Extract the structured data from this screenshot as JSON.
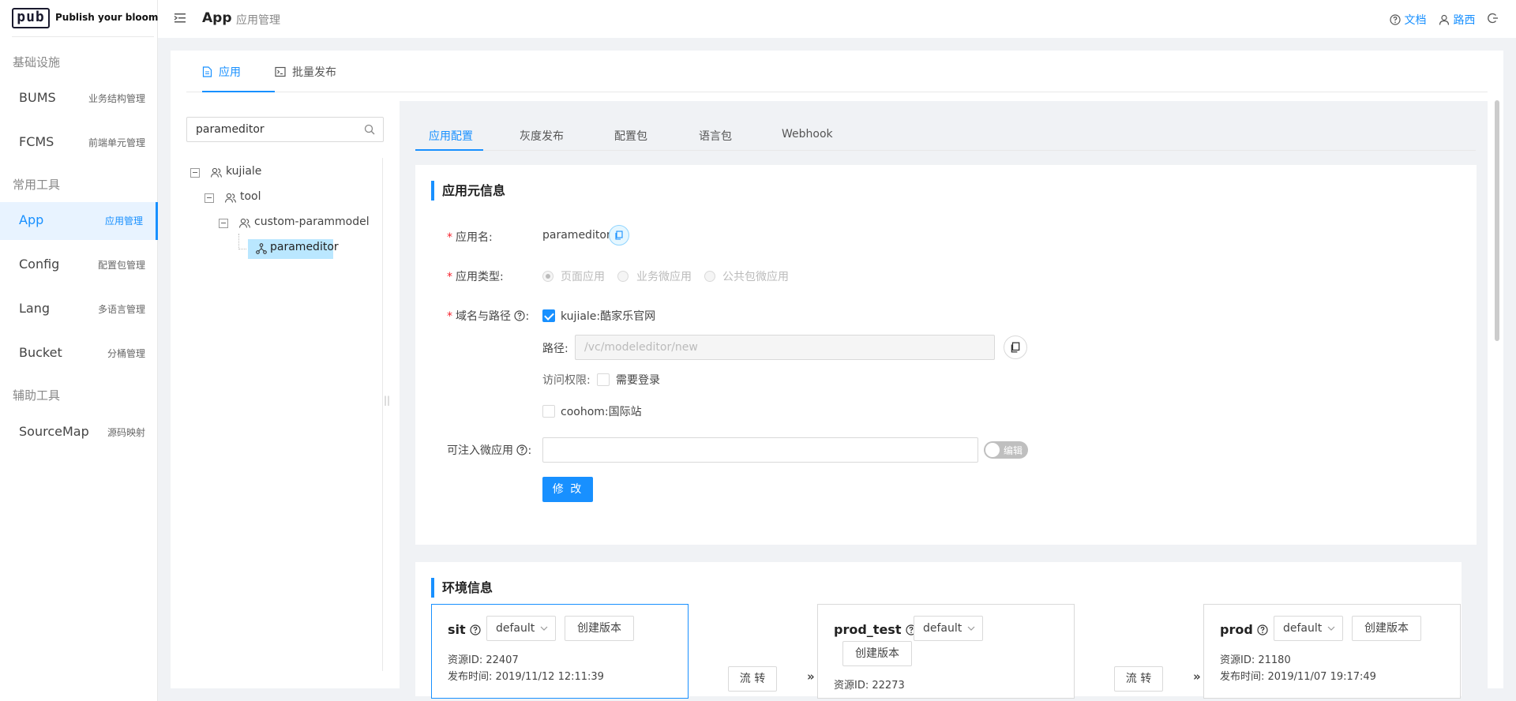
{
  "brand": {
    "logo": "pub",
    "tagline": "Publish your bloom!"
  },
  "sidebar": {
    "groups": [
      "基础设施",
      "常用工具",
      "辅助工具"
    ],
    "items": [
      {
        "en": "BUMS",
        "cn": "业务结构管理"
      },
      {
        "en": "FCMS",
        "cn": "前端单元管理"
      },
      {
        "en": "App",
        "cn": "应用管理"
      },
      {
        "en": "Config",
        "cn": "配置包管理"
      },
      {
        "en": "Lang",
        "cn": "多语言管理"
      },
      {
        "en": "Bucket",
        "cn": "分桶管理"
      },
      {
        "en": "SourceMap",
        "cn": "源码映射"
      }
    ],
    "active_index": 2
  },
  "header": {
    "title": "App",
    "subtitle": "应用管理",
    "docs": "文档",
    "user": "路西"
  },
  "main_tabs": [
    {
      "label": "应用",
      "icon": "file-icon"
    },
    {
      "label": "批量发布",
      "icon": "terminal-icon"
    }
  ],
  "search": {
    "value": "parameditor"
  },
  "tree": [
    {
      "label": "kujiale",
      "icon": "team-icon"
    },
    {
      "label": "tool",
      "icon": "team-icon"
    },
    {
      "label": "custom-parammodel",
      "icon": "team-icon"
    },
    {
      "label": "parameditor",
      "icon": "app-node-icon",
      "selected": true
    }
  ],
  "sub_tabs": [
    "应用配置",
    "灰度发布",
    "配置包",
    "语言包",
    "Webhook"
  ],
  "meta_card": {
    "title": "应用元信息",
    "app_name_label": "应用名:",
    "app_name": "parameditor",
    "app_type_label": "应用类型:",
    "app_types": [
      "页面应用",
      "业务微应用",
      "公共包微应用"
    ],
    "domain_label": "域名与路径",
    "domain_primary": "kujiale:酷家乐官网",
    "path_label": "路径:",
    "path_value": "/vc/modeleditor/new",
    "access_label": "访问权限:",
    "access_login": "需要登录",
    "domain_secondary": "coohom:国际站",
    "inject_label": "可注入微应用",
    "toggle_label": "编辑",
    "submit": "修 改"
  },
  "env_card": {
    "title": "环境信息",
    "envs": [
      {
        "name": "sit",
        "branch": "default",
        "create": "创建版本",
        "resource": "资源ID:  22407",
        "published": "发布时间:  2019/11/12 12:11:39"
      },
      {
        "name": "prod_test",
        "branch": "default",
        "create": "创建版本",
        "resource": "资源ID:  22273"
      },
      {
        "name": "prod",
        "branch": "default",
        "create": "创建版本",
        "resource": "资源ID:  21180",
        "published": "发布时间:  2019/11/07 19:17:49"
      }
    ],
    "flow_label": "流 转",
    "flow_arrow": "»"
  },
  "colors": {
    "primary": "#1890ff",
    "required": "#f5222d"
  }
}
